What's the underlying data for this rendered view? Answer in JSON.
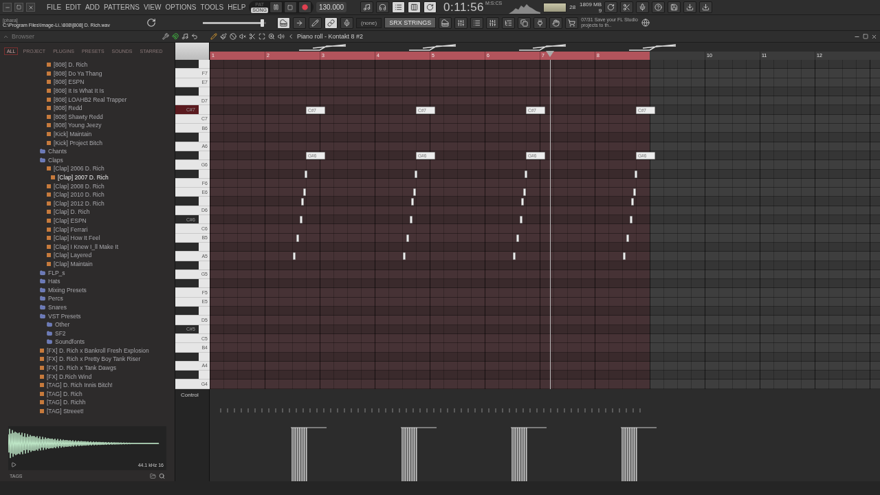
{
  "menu": [
    "FILE",
    "EDIT",
    "ADD",
    "PATTERNS",
    "VIEW",
    "OPTIONS",
    "TOOLS",
    "HELP"
  ],
  "transport": {
    "modes": [
      {
        "label": "PAT",
        "selected": false
      },
      {
        "label": "SONG",
        "selected": true
      }
    ],
    "tempo": "130.000"
  },
  "clock": {
    "time": "0:11:56",
    "unit": "M:S:CS"
  },
  "monitor": {
    "cpu": "28",
    "memory": "1809 MB",
    "polyphony": "9"
  },
  "hint": {
    "title": "[phara]",
    "path": "C:\\Program Files\\Image-Li..\\808\\[808] D. Rich.wav"
  },
  "master_pitch": {
    "level": 0.97
  },
  "pattern_selector": "(none)",
  "channel_name": "SRX STRINGS",
  "news": {
    "date": "07/31",
    "text": "Save your FL Studio projects to th.."
  },
  "browser": {
    "title": "Browser",
    "tabs": [
      {
        "label": "ALL",
        "selected": true
      },
      {
        "label": "PROJECT",
        "selected": false
      },
      {
        "label": "PLUGINS",
        "selected": false
      },
      {
        "label": "PRESETS",
        "selected": false
      },
      {
        "label": "SOUNDS",
        "selected": false
      },
      {
        "label": "STARRED",
        "selected": false
      }
    ],
    "continued_items": [
      {
        "label": "[808] D. Rich",
        "kind": "file",
        "selected": false
      },
      {
        "label": "[808] Do Ya Thang",
        "kind": "file",
        "selected": false
      },
      {
        "label": "[808] ESPN",
        "kind": "file",
        "selected": false
      },
      {
        "label": "[808] It Is What It Is",
        "kind": "file",
        "selected": false
      },
      {
        "label": "[808] LOAHB2 Real Trapper",
        "kind": "file",
        "selected": false
      },
      {
        "label": "[808] Redd",
        "kind": "file",
        "selected": false
      },
      {
        "label": "[808] Shawty Redd",
        "kind": "file",
        "selected": false
      },
      {
        "label": "[808] Young Jeezy",
        "kind": "file",
        "selected": false
      },
      {
        "label": "[Kick] Maintain",
        "kind": "file",
        "selected": false
      },
      {
        "label": "[Kick] Project Bitch",
        "kind": "file",
        "selected": false
      }
    ],
    "items": [
      {
        "label": "Chants",
        "kind": "folder",
        "selected": false
      },
      {
        "label": "Claps",
        "kind": "folder",
        "selected": false,
        "children": [
          {
            "label": "[Clap] 2006 D. Rich",
            "kind": "file",
            "selected": false
          },
          {
            "label": "[Clap] 2007 D. Rich",
            "kind": "file",
            "selected": true
          },
          {
            "label": "[Clap] 2008 D. Rich",
            "kind": "file",
            "selected": false
          },
          {
            "label": "[Clap] 2010 D. Rich",
            "kind": "file",
            "selected": false
          },
          {
            "label": "[Clap] 2012 D. Rich",
            "kind": "file",
            "selected": false
          },
          {
            "label": "[Clap] D. Rich",
            "kind": "file",
            "selected": false
          },
          {
            "label": "[Clap] ESPN",
            "kind": "file",
            "selected": false
          },
          {
            "label": "[Clap] Ferrari",
            "kind": "file",
            "selected": false
          },
          {
            "label": "[Clap] How It Feel",
            "kind": "file",
            "selected": false
          },
          {
            "label": "[Clap] I Knew I_ll Make It",
            "kind": "file",
            "selected": false
          },
          {
            "label": "[Clap] Layered",
            "kind": "file",
            "selected": false
          },
          {
            "label": "[Clap] Maintain",
            "kind": "file",
            "selected": false
          }
        ]
      },
      {
        "label": "FLP_s",
        "kind": "folder",
        "selected": false
      },
      {
        "label": "Hats",
        "kind": "folder",
        "selected": false
      },
      {
        "label": "Mixing Presets",
        "kind": "folder",
        "selected": false
      },
      {
        "label": "Percs",
        "kind": "folder",
        "selected": false
      },
      {
        "label": "Snares",
        "kind": "folder",
        "selected": false
      },
      {
        "label": "VST Presets",
        "kind": "folder",
        "selected": false,
        "children": [
          {
            "label": "Other",
            "kind": "folder",
            "selected": false
          },
          {
            "label": "SF2",
            "kind": "folder",
            "selected": false
          },
          {
            "label": "Soundfonts",
            "kind": "folder",
            "selected": false
          }
        ]
      },
      {
        "label": "[FX] D. Rich x Bankroll Fresh Explosion",
        "kind": "file",
        "selected": false
      },
      {
        "label": "[FX] D. Rich x Pretty Boy Tank Riser",
        "kind": "file",
        "selected": false
      },
      {
        "label": "[FX] D. Rich x Tank Dawgs",
        "kind": "file",
        "selected": false
      },
      {
        "label": "[FX] D.Rich Wind",
        "kind": "file",
        "selected": false
      },
      {
        "label": "[TAG] D. Rich Innis Bitch!",
        "kind": "file",
        "selected": false
      },
      {
        "label": "[TAG] D. Rich",
        "kind": "file",
        "selected": false
      },
      {
        "label": "[TAG] D. Richh",
        "kind": "file",
        "selected": false
      },
      {
        "label": "[TAG] Streeet!",
        "kind": "file",
        "selected": false
      }
    ],
    "sample_info": "44.1 kHz 16",
    "tags_label": "TAGS"
  },
  "piano_roll": {
    "title": "Piano roll - Kontakt 8 #2",
    "loop_bars": [
      "1",
      "2",
      "3",
      "4",
      "5",
      "6",
      "7",
      "8"
    ],
    "other_bars": [
      "10",
      "11",
      "12"
    ],
    "keys": [
      {
        "kind": "black",
        "highlighted": false
      },
      {
        "label": "F7",
        "kind": "white",
        "highlighted": false
      },
      {
        "label": "E7",
        "kind": "white",
        "highlighted": false
      },
      {
        "kind": "black",
        "highlighted": false
      },
      {
        "label": "D7",
        "kind": "white",
        "highlighted": false
      },
      {
        "label": "C#7",
        "kind": "black",
        "highlighted": true
      },
      {
        "label": "C7",
        "kind": "white",
        "highlighted": false
      },
      {
        "label": "B6",
        "kind": "white",
        "highlighted": false
      },
      {
        "kind": "black",
        "highlighted": false
      },
      {
        "label": "A6",
        "kind": "white",
        "highlighted": false
      },
      {
        "kind": "black",
        "highlighted": false
      },
      {
        "label": "G6",
        "kind": "white",
        "highlighted": false
      },
      {
        "kind": "black",
        "highlighted": false
      },
      {
        "label": "F6",
        "kind": "white",
        "highlighted": false
      },
      {
        "label": "E6",
        "kind": "white",
        "highlighted": false
      },
      {
        "kind": "black",
        "highlighted": false
      },
      {
        "label": "D6",
        "kind": "white",
        "highlighted": false
      },
      {
        "label": "C#6",
        "kind": "black",
        "highlighted": false
      },
      {
        "label": "C6",
        "kind": "white",
        "highlighted": false
      },
      {
        "label": "B5",
        "kind": "white",
        "highlighted": false
      },
      {
        "kind": "black",
        "highlighted": false
      },
      {
        "label": "A5",
        "kind": "white",
        "highlighted": false
      },
      {
        "kind": "black",
        "highlighted": false
      },
      {
        "label": "G5",
        "kind": "white",
        "highlighted": false
      },
      {
        "kind": "black",
        "highlighted": false
      },
      {
        "label": "F5",
        "kind": "white",
        "highlighted": false
      },
      {
        "label": "E5",
        "kind": "white",
        "highlighted": false
      },
      {
        "kind": "black",
        "highlighted": false
      },
      {
        "label": "D5",
        "kind": "white",
        "highlighted": false
      },
      {
        "label": "C#5",
        "kind": "black",
        "highlighted": false
      },
      {
        "label": "C5",
        "kind": "white",
        "highlighted": false
      },
      {
        "label": "B4",
        "kind": "white",
        "highlighted": false
      },
      {
        "kind": "black",
        "highlighted": false
      },
      {
        "label": "A4",
        "kind": "white",
        "highlighted": false
      },
      {
        "kind": "black",
        "highlighted": false
      },
      {
        "label": "G4",
        "kind": "white",
        "highlighted": false
      }
    ],
    "patterns": [
      {
        "notes": [
          {
            "kind": "long",
            "label": "C#7"
          },
          {
            "kind": "long",
            "label": "G#6"
          },
          {
            "kind": "short"
          },
          {
            "kind": "short"
          },
          {
            "kind": "short"
          },
          {
            "kind": "short"
          },
          {
            "kind": "short"
          },
          {
            "kind": "short"
          }
        ]
      },
      {
        "notes": [
          {
            "kind": "long",
            "label": "C#7"
          },
          {
            "kind": "long",
            "label": "G#6"
          },
          {
            "kind": "short"
          },
          {
            "kind": "short"
          },
          {
            "kind": "short"
          },
          {
            "kind": "short"
          },
          {
            "kind": "short"
          },
          {
            "kind": "short"
          }
        ]
      },
      {
        "notes": [
          {
            "kind": "long",
            "label": "C#7"
          },
          {
            "kind": "long",
            "label": "G#6"
          },
          {
            "kind": "short"
          },
          {
            "kind": "short"
          },
          {
            "kind": "short"
          },
          {
            "kind": "short"
          },
          {
            "kind": "short"
          },
          {
            "kind": "short"
          }
        ]
      },
      {
        "notes": [
          {
            "kind": "long",
            "label": "C#7"
          },
          {
            "kind": "long",
            "label": "G#6"
          },
          {
            "kind": "short"
          },
          {
            "kind": "short"
          },
          {
            "kind": "short"
          },
          {
            "kind": "short"
          },
          {
            "kind": "short"
          },
          {
            "kind": "short"
          }
        ]
      }
    ],
    "control": "Control"
  }
}
